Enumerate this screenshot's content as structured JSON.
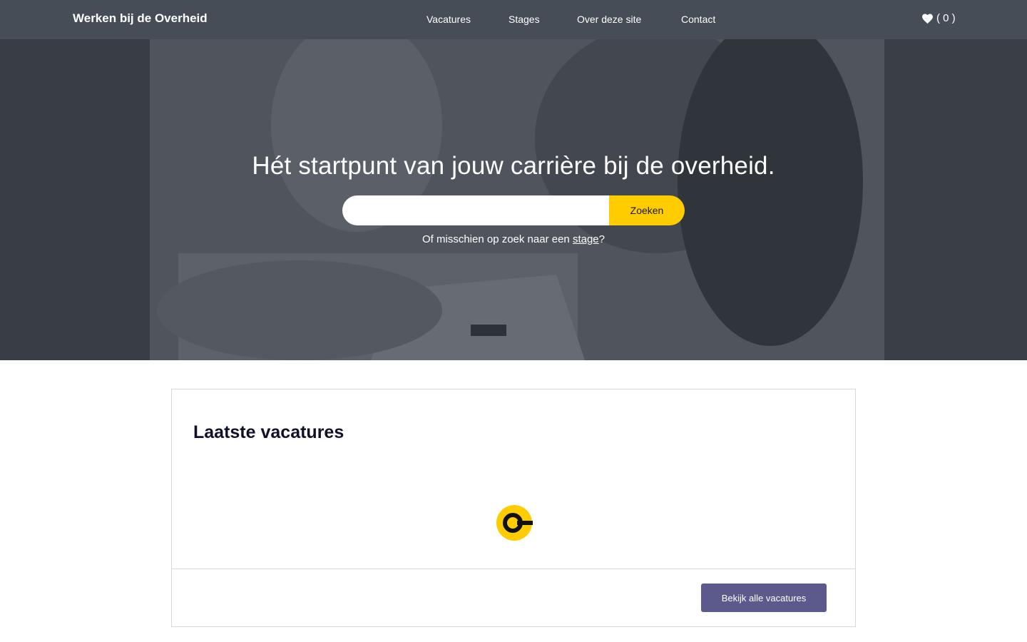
{
  "header": {
    "brand": "Werken bij de Overheid",
    "nav": [
      {
        "label": "Vacatures"
      },
      {
        "label": "Stages"
      },
      {
        "label": "Over deze site"
      },
      {
        "label": "Contact"
      }
    ],
    "favorites_label": "( 0 )",
    "favorites_count": 0,
    "bar_color": "#474d56"
  },
  "hero": {
    "title": "Hét startpunt van jouw carrière bij de overheid.",
    "search": {
      "value": "",
      "placeholder": "",
      "button_label": "Zoeken"
    },
    "hint_prefix": "Of misschien op zoek naar een ",
    "hint_link": "stage",
    "hint_suffix": "?"
  },
  "vacancies": {
    "title": "Laatste vacatures",
    "loader_icon": "loading-spinner-icon",
    "button_label": "Bekijk alle vacatures"
  },
  "colors": {
    "accent_yellow": "#ffcc00",
    "button_purple": "#5c5a8c"
  }
}
